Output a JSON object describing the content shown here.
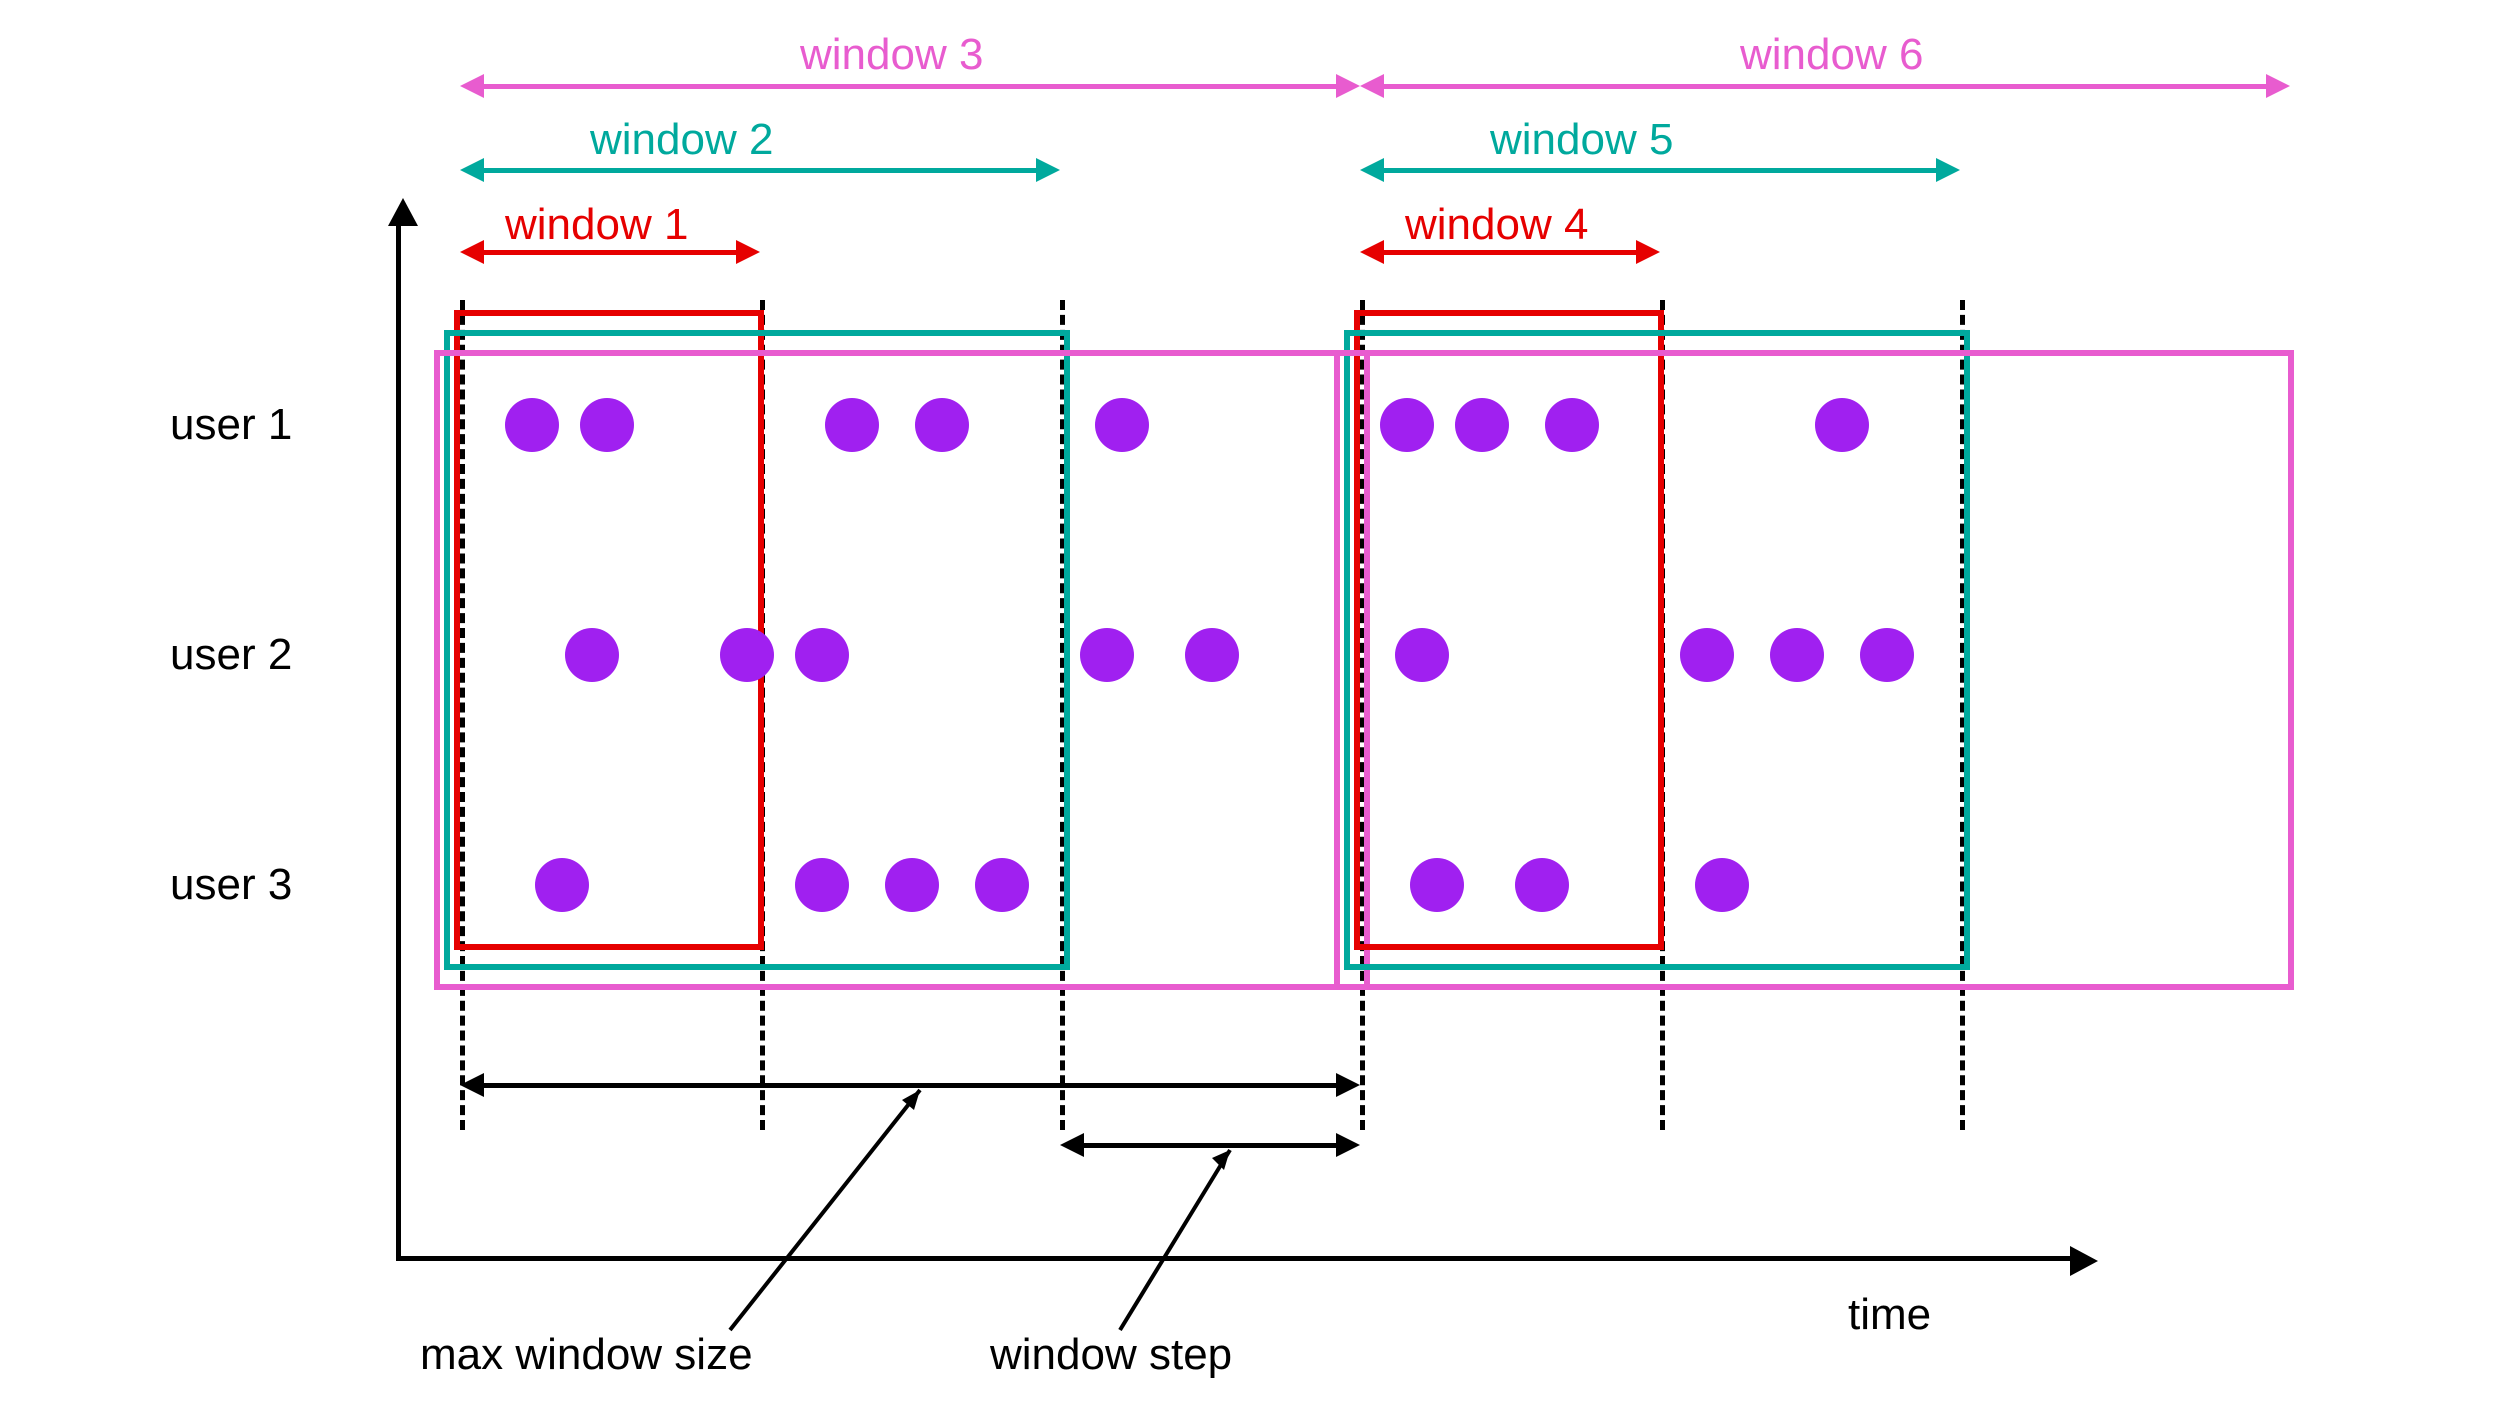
{
  "axis": {
    "x_label": "time"
  },
  "users": [
    {
      "label": "user 1"
    },
    {
      "label": "user 2"
    },
    {
      "label": "user 3"
    }
  ],
  "windows": [
    {
      "label": "window 1",
      "color": "red"
    },
    {
      "label": "window 2",
      "color": "teal"
    },
    {
      "label": "window 3",
      "color": "magenta"
    },
    {
      "label": "window 4",
      "color": "red"
    },
    {
      "label": "window 5",
      "color": "teal"
    },
    {
      "label": "window 6",
      "color": "magenta"
    }
  ],
  "annotations": {
    "max_window_size": "max window size",
    "window_step": "window step"
  },
  "chart_data": {
    "type": "scatter",
    "title": "",
    "xlabel": "time",
    "ylabel": "",
    "grid": false,
    "x_breakpoints": [
      0,
      1,
      2,
      3,
      4,
      5
    ],
    "note": "x positions are approximate, read off along the time axis in units of the window-step width",
    "series": [
      {
        "name": "user 1",
        "x": [
          0.2,
          0.45,
          1.25,
          1.55,
          2.15,
          3.1,
          3.35,
          3.65,
          4.55
        ]
      },
      {
        "name": "user 2",
        "x": [
          0.4,
          0.9,
          1.15,
          2.1,
          2.45,
          3.15,
          4.1,
          4.4,
          4.7
        ]
      },
      {
        "name": "user 3",
        "x": [
          0.3,
          1.15,
          1.45,
          1.75,
          3.2,
          3.55,
          4.15
        ]
      }
    ],
    "window_step": 1,
    "max_window_size": 3,
    "windows": [
      {
        "name": "window 1",
        "start": 0,
        "end": 1,
        "color": "#e60000"
      },
      {
        "name": "window 2",
        "start": 0,
        "end": 2,
        "color": "#00a99d"
      },
      {
        "name": "window 3",
        "start": 0,
        "end": 3,
        "color": "#e85ccf"
      },
      {
        "name": "window 4",
        "start": 3,
        "end": 4,
        "color": "#e60000"
      },
      {
        "name": "window 5",
        "start": 3,
        "end": 5,
        "color": "#00a99d"
      },
      {
        "name": "window 6",
        "start": 3,
        "end": 6,
        "color": "#e85ccf"
      }
    ]
  },
  "colors": {
    "red": "#e60000",
    "teal": "#00a99d",
    "magenta": "#e85ccf",
    "purple": "#a020f0",
    "black": "#000000"
  }
}
